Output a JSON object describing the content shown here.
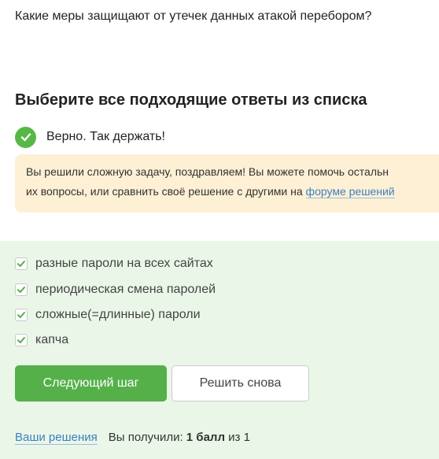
{
  "question": {
    "text": "Какие меры защищают от утечек данных атакой перебором?"
  },
  "section": {
    "title": "Выберите все подходящие ответы из списка"
  },
  "status": {
    "icon": "checkmark-circle-icon",
    "color": "#57b847",
    "text": "Верно. Так держать!"
  },
  "hint": {
    "line1": "Вы решили сложную задачу, поздравляем! Вы можете помочь остальн",
    "line2_prefix": "их вопросы, или сравнить своё решение с другими на ",
    "link_text": "форуме решений"
  },
  "options": [
    {
      "label": "разные пароли на всех сайтах",
      "checked": true
    },
    {
      "label": "периодическая смена паролей",
      "checked": true
    },
    {
      "label": "сложные(=длинные) пароли",
      "checked": true
    },
    {
      "label": "капча",
      "checked": true
    }
  ],
  "buttons": {
    "next_label": "Следующий шаг",
    "retry_label": "Решить снова"
  },
  "footer": {
    "solutions_link": "Ваши решения",
    "score_prefix": "Вы получили: ",
    "score_value": "1 балл",
    "score_suffix": " из 1"
  },
  "colors": {
    "accent_green": "#55b04a",
    "panel_bg": "#eaf7e8",
    "hint_bg": "#fdf0d4",
    "link": "#3d7fc1"
  }
}
